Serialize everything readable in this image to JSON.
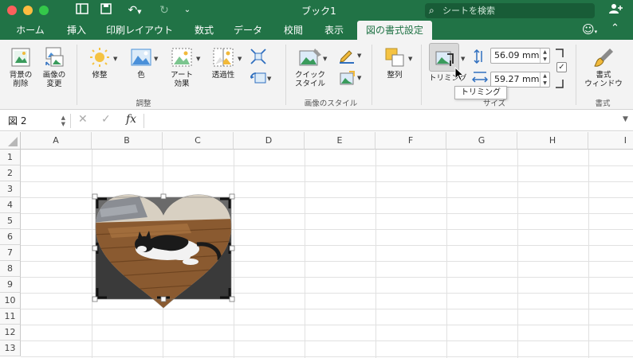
{
  "window": {
    "title": "ブック1"
  },
  "search": {
    "placeholder": "シートを検索"
  },
  "tabs": [
    {
      "label": "ホーム"
    },
    {
      "label": "挿入"
    },
    {
      "label": "印刷レイアウト"
    },
    {
      "label": "数式"
    },
    {
      "label": "データ"
    },
    {
      "label": "校閲"
    },
    {
      "label": "表示"
    },
    {
      "label": "図の書式設定",
      "active": true
    }
  ],
  "ribbon": {
    "remove_bg": "背景の\n削除",
    "change_picture": "画像の\n変更",
    "corrections": "修整",
    "color": "色",
    "artistic": "アート\n効果",
    "transparency": "透過性",
    "group_adjust": "調整",
    "quick_styles": "クイック\nスタイル",
    "group_styles": "画像のスタイル",
    "arrange": "整列",
    "crop": "トリミング",
    "height_value": "56.09 mm",
    "width_value": "59.27 mm",
    "group_size": "サイズ",
    "format_pane": "書式\nウィンドウ",
    "group_format": "書式",
    "tooltip": "トリミング"
  },
  "formula_bar": {
    "name_box": "図 2",
    "formula": ""
  },
  "sheet": {
    "columns": [
      "A",
      "B",
      "C",
      "D",
      "E",
      "F",
      "G",
      "H",
      "I"
    ],
    "rows": [
      "1",
      "2",
      "3",
      "4",
      "5",
      "6",
      "7",
      "8",
      "9",
      "10",
      "11",
      "12",
      "13"
    ]
  },
  "colors": {
    "accent": "#217346",
    "ribbon_bg": "#f3f3f3"
  }
}
